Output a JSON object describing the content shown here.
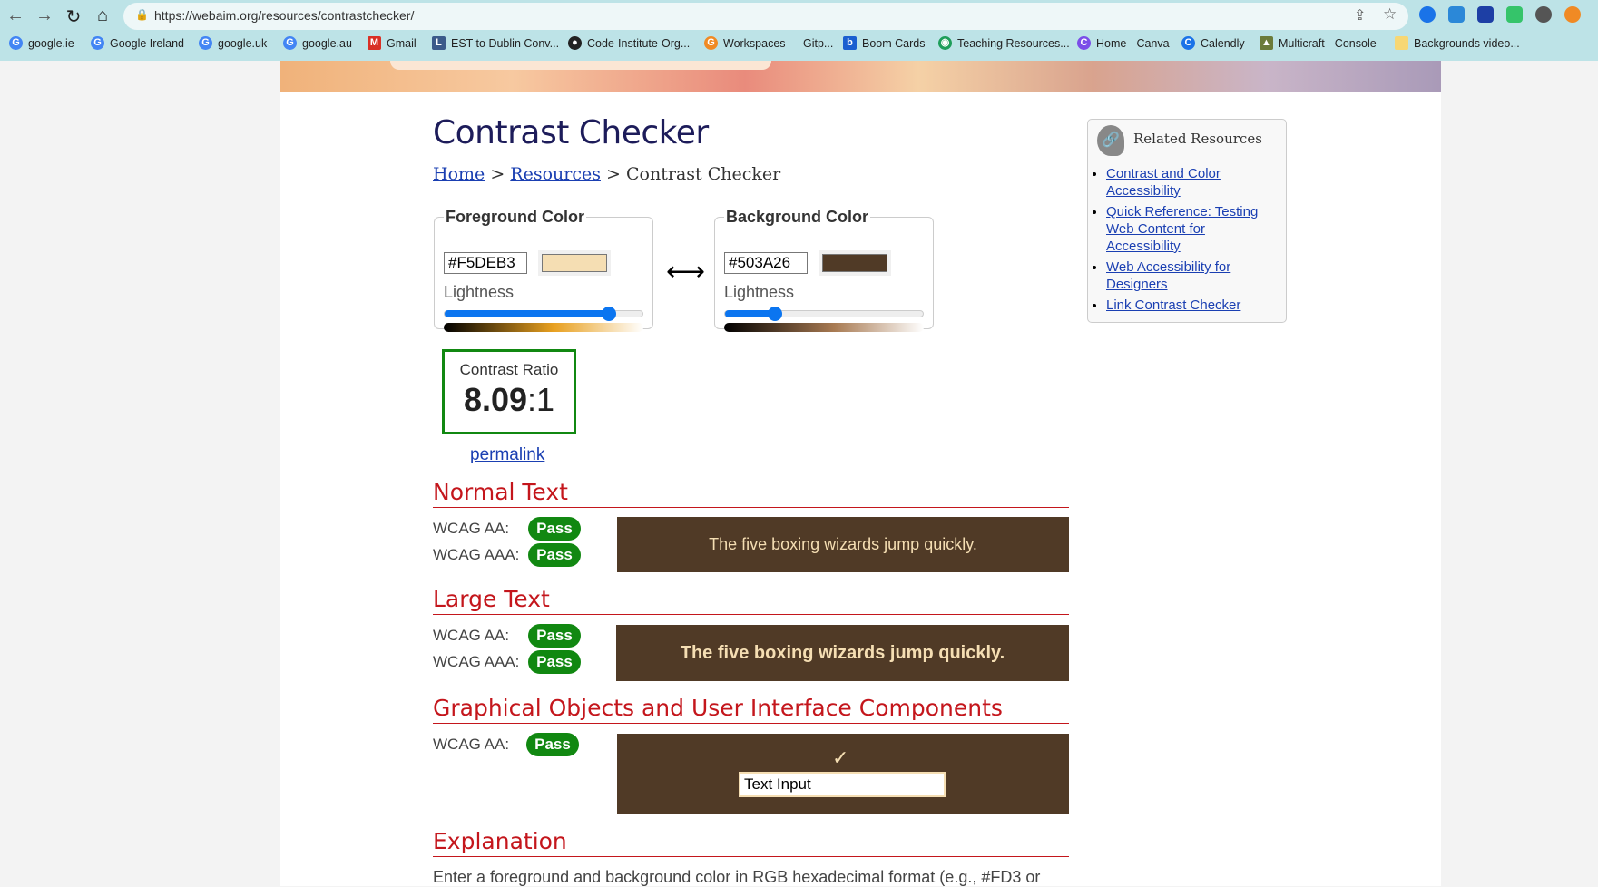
{
  "browser": {
    "url": "https://webaim.org/resources/contrastchecker/",
    "bookmarks": [
      "google.ie",
      "Google Ireland",
      "google.uk",
      "google.au",
      "Gmail",
      "EST to Dublin Conv...",
      "Code-Institute-Org...",
      "Workspaces — Gitp...",
      "Boom Cards",
      "Teaching Resources...",
      "Home - Canva",
      "Calendly",
      "Multicraft - Console",
      "Backgrounds video..."
    ]
  },
  "page": {
    "title": "Contrast Checker",
    "breadcrumb": {
      "home": "Home",
      "sep1": ">",
      "resources": "Resources",
      "sep2": ">",
      "current": "Contrast Checker"
    },
    "foreground": {
      "legend": "Foreground Color",
      "hex": "#F5DEB3",
      "color": "#f5deb3",
      "lightness_label": "Lightness",
      "lightness_pct": 83
    },
    "background": {
      "legend": "Background Color",
      "hex": "#503A26",
      "color": "#503a26",
      "lightness_label": "Lightness",
      "lightness_pct": 25
    },
    "swap": "⟷",
    "ratio": {
      "label": "Contrast Ratio",
      "value": "8.09",
      "suffix": ":1"
    },
    "permalink": "permalink",
    "normal": {
      "heading": "Normal Text",
      "aa": "WCAG AA:",
      "aa_result": "Pass",
      "aaa": "WCAG AAA:",
      "aaa_result": "Pass",
      "sample": "The five boxing wizards jump quickly."
    },
    "large": {
      "heading": "Large Text",
      "aa": "WCAG AA:",
      "aa_result": "Pass",
      "aaa": "WCAG AAA:",
      "aaa_result": "Pass",
      "sample": "The five boxing wizards jump quickly."
    },
    "graphical": {
      "heading": "Graphical Objects and User Interface Components",
      "aa": "WCAG AA:",
      "aa_result": "Pass",
      "check": "✓",
      "input": "Text Input"
    },
    "explanation": {
      "heading": "Explanation",
      "text": "Enter a foreground and background color in RGB hexadecimal format (e.g., #FD3 or"
    }
  },
  "related": {
    "title": "Related Resources",
    "links": [
      "Contrast and Color Accessibility",
      "Quick Reference: Testing Web Content for Accessibility",
      "Web Accessibility for Designers",
      "Link Contrast Checker"
    ]
  }
}
